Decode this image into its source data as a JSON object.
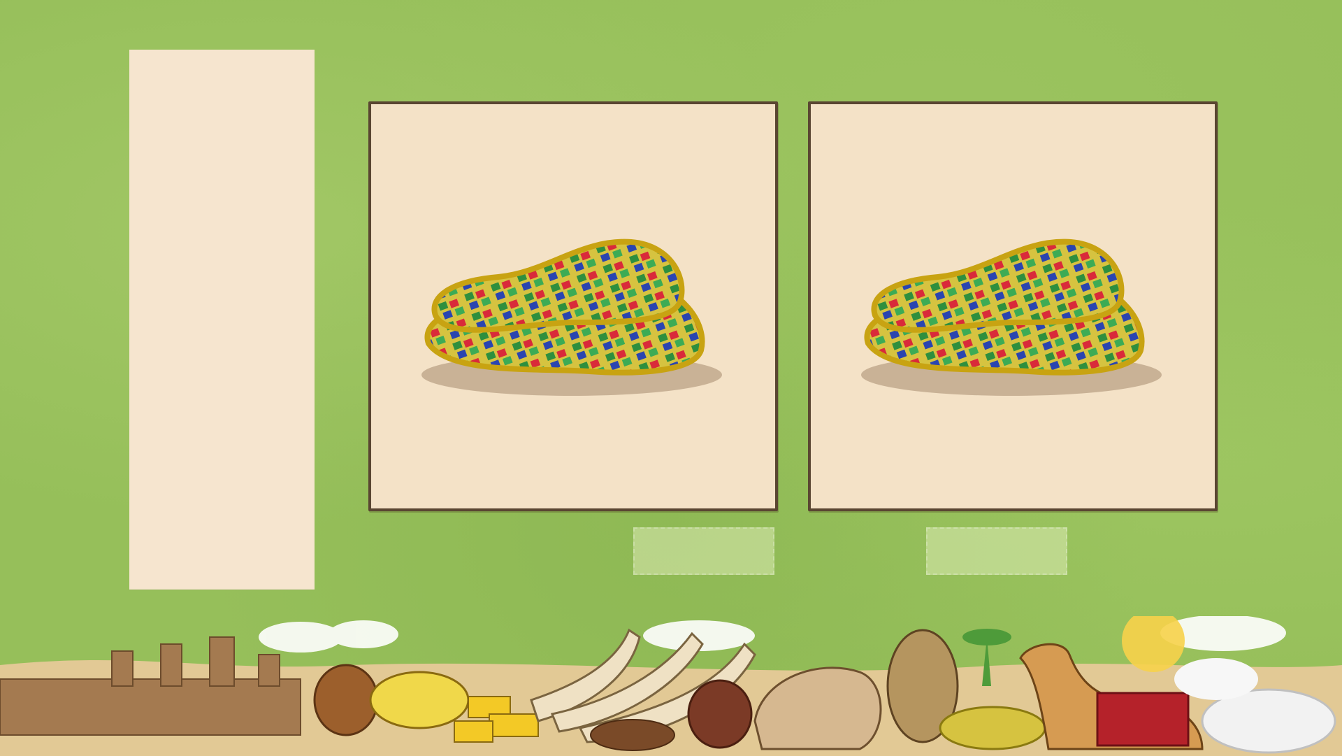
{
  "scene": {
    "background_color": "#96bf5a",
    "panel_color": "#f6e5cf",
    "card_color": "#f4e2c7",
    "card_border_color": "#5a4632"
  },
  "cards": [
    {
      "item_icon": "patterned-shoes-icon"
    },
    {
      "item_icon": "patterned-shoes-icon"
    }
  ],
  "footer_decor": [
    "mud-mosque-icon",
    "clay-pot-icon",
    "gold-dust-bowl-icon",
    "gold-bars-icon",
    "ivory-tusks-icon",
    "dates-bowl-icon",
    "lion-statue-icon",
    "tribal-mask-icon",
    "shoes-icon",
    "camel-icon",
    "salt-pile-icon",
    "palm-tree-icon",
    "sun-icon"
  ]
}
